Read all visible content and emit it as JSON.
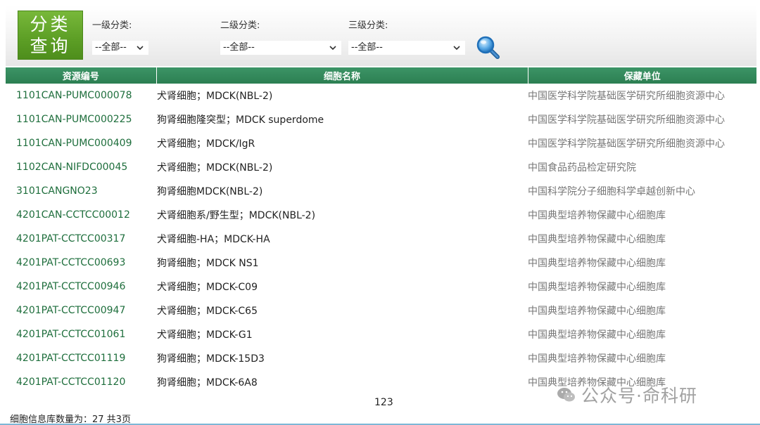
{
  "filters": {
    "category_button": {
      "line1": "分类",
      "line2": "查询"
    },
    "level1": {
      "label": "一级分类:",
      "selected": "--全部--"
    },
    "level2": {
      "label": "二级分类:",
      "selected": "--全部--"
    },
    "level3": {
      "label": "三级分类:",
      "selected": "--全部--"
    },
    "search_icon": "magnifier-icon"
  },
  "table": {
    "headers": [
      "资源编号",
      "细胞名称",
      "保藏单位"
    ],
    "rows": [
      {
        "id": "1101CAN-PUMC000078",
        "name": "犬肾细胞；MDCK(NBL-2)",
        "unit": "中国医学科学院基础医学研究所细胞资源中心"
      },
      {
        "id": "1101CAN-PUMC000225",
        "name": "狗肾细胞隆突型；MDCK superdome",
        "unit": "中国医学科学院基础医学研究所细胞资源中心"
      },
      {
        "id": "1101CAN-PUMC000409",
        "name": "犬肾细胞；MDCK/IgR",
        "unit": "中国医学科学院基础医学研究所细胞资源中心"
      },
      {
        "id": "1102CAN-NIFDC00045",
        "name": "犬肾细胞；MDCK(NBL-2)",
        "unit": "中国食品药品检定研究院"
      },
      {
        "id": "3101CANGNO23",
        "name": "狗肾细胞MDCK(NBL-2)",
        "unit": "中国科学院分子细胞科学卓越创新中心"
      },
      {
        "id": "4201CAN-CCTCC00012",
        "name": "犬肾细胞系/野生型；MDCK(NBL-2)",
        "unit": "中国典型培养物保藏中心细胞库"
      },
      {
        "id": "4201PAT-CCTCC00317",
        "name": "犬肾细胞-HA；MDCK-HA",
        "unit": "中国典型培养物保藏中心细胞库"
      },
      {
        "id": "4201PAT-CCTCC00693",
        "name": "狗肾细胞；MDCK NS1",
        "unit": "中国典型培养物保藏中心细胞库"
      },
      {
        "id": "4201PAT-CCTCC00946",
        "name": "犬肾细胞；MDCK-C09",
        "unit": "中国典型培养物保藏中心细胞库"
      },
      {
        "id": "4201PAT-CCTCC00947",
        "name": "犬肾细胞；MDCK-C65",
        "unit": "中国典型培养物保藏中心细胞库"
      },
      {
        "id": "4201PAT-CCTCC01061",
        "name": "犬肾细胞；MDCK-G1",
        "unit": "中国典型培养物保藏中心细胞库"
      },
      {
        "id": "4201PAT-CCTCC01119",
        "name": "狗肾细胞；MDCK-15D3",
        "unit": "中国典型培养物保藏中心细胞库"
      },
      {
        "id": "4201PAT-CCTCC01120",
        "name": "狗肾细胞；MDCK-6A8",
        "unit": "中国典型培养物保藏中心细胞库"
      }
    ]
  },
  "pager": {
    "pages": "123"
  },
  "summary": "细胞信息库数量为：27  共3页",
  "watermark": {
    "text": "公众号·命科研",
    "icon": "wechat-icon"
  },
  "colors": {
    "header_green": "#2e8b57",
    "button_green": "#5c9e25",
    "id_text": "#1e6e3c",
    "unit_text": "#777777"
  }
}
